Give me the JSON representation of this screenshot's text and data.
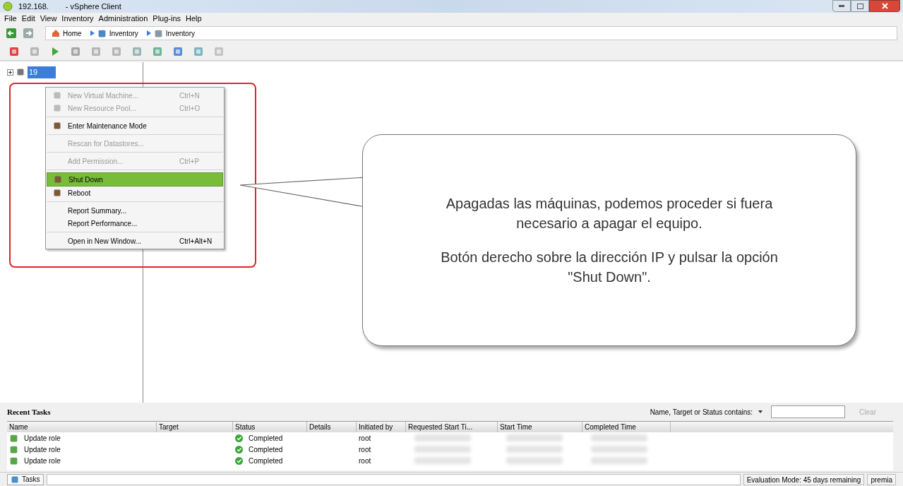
{
  "window": {
    "host": "192.168.",
    "title": "- vSphere Client"
  },
  "menu_bar": [
    "File",
    "Edit",
    "View",
    "Inventory",
    "Administration",
    "Plug-ins",
    "Help"
  ],
  "breadcrumb": [
    "Home",
    "Inventory",
    "Inventory"
  ],
  "tree": [
    {
      "label": "19",
      "selected": true,
      "expanded": false
    }
  ],
  "context_menu": [
    {
      "label": "New Virtual Machine...",
      "shortcut": "Ctrl+N",
      "disabled": true,
      "selected": false,
      "has_icon": true,
      "separator_after": false
    },
    {
      "label": "New Resource Pool...",
      "shortcut": "Ctrl+O",
      "disabled": true,
      "selected": false,
      "has_icon": true,
      "separator_after": true
    },
    {
      "label": "Enter Maintenance Mode",
      "disabled": false,
      "selected": false,
      "has_icon": true,
      "separator_after": true
    },
    {
      "label": "Rescan for Datastores...",
      "disabled": true,
      "selected": false,
      "has_icon": false,
      "separator_after": true
    },
    {
      "label": "Add Permission...",
      "shortcut": "Ctrl+P",
      "disabled": true,
      "selected": false,
      "has_icon": false,
      "separator_after": true
    },
    {
      "label": "Shut Down",
      "disabled": false,
      "selected": true,
      "has_icon": true,
      "separator_after": false
    },
    {
      "label": "Reboot",
      "disabled": false,
      "selected": false,
      "has_icon": true,
      "separator_after": true
    },
    {
      "label": "Report Summary...",
      "disabled": false,
      "selected": false,
      "has_icon": false,
      "separator_after": false
    },
    {
      "label": "Report Performance...",
      "disabled": false,
      "selected": false,
      "has_icon": false,
      "separator_after": true
    },
    {
      "label": "Open in New Window...",
      "shortcut": "Ctrl+Alt+N",
      "disabled": false,
      "selected": false,
      "has_icon": false,
      "separator_after": false
    }
  ],
  "callout": {
    "paragraphs": [
      "Apagadas las máquinas, podemos proceder si fuera necesario a apagar el equipo.",
      "Botón derecho sobre la dirección IP y pulsar la opción \"Shut Down\"."
    ]
  },
  "recent_tasks": {
    "title": "Recent Tasks",
    "filter_label": "Name, Target or Status contains:",
    "clear": "Clear",
    "columns": [
      "Name",
      "Target",
      "Status",
      "Details",
      "Initiated by",
      "Requested Start Ti...",
      "Start Time",
      "Completed Time"
    ],
    "rows": [
      {
        "name": "Update role",
        "status": "Completed",
        "initiated_by": "root"
      },
      {
        "name": "Update role",
        "status": "Completed",
        "initiated_by": "root"
      },
      {
        "name": "Update role",
        "status": "Completed",
        "initiated_by": "root"
      }
    ]
  },
  "status_bar": {
    "tab": "Tasks",
    "evaluation": "Evaluation Mode: 45 days remaining",
    "user": "premia"
  }
}
